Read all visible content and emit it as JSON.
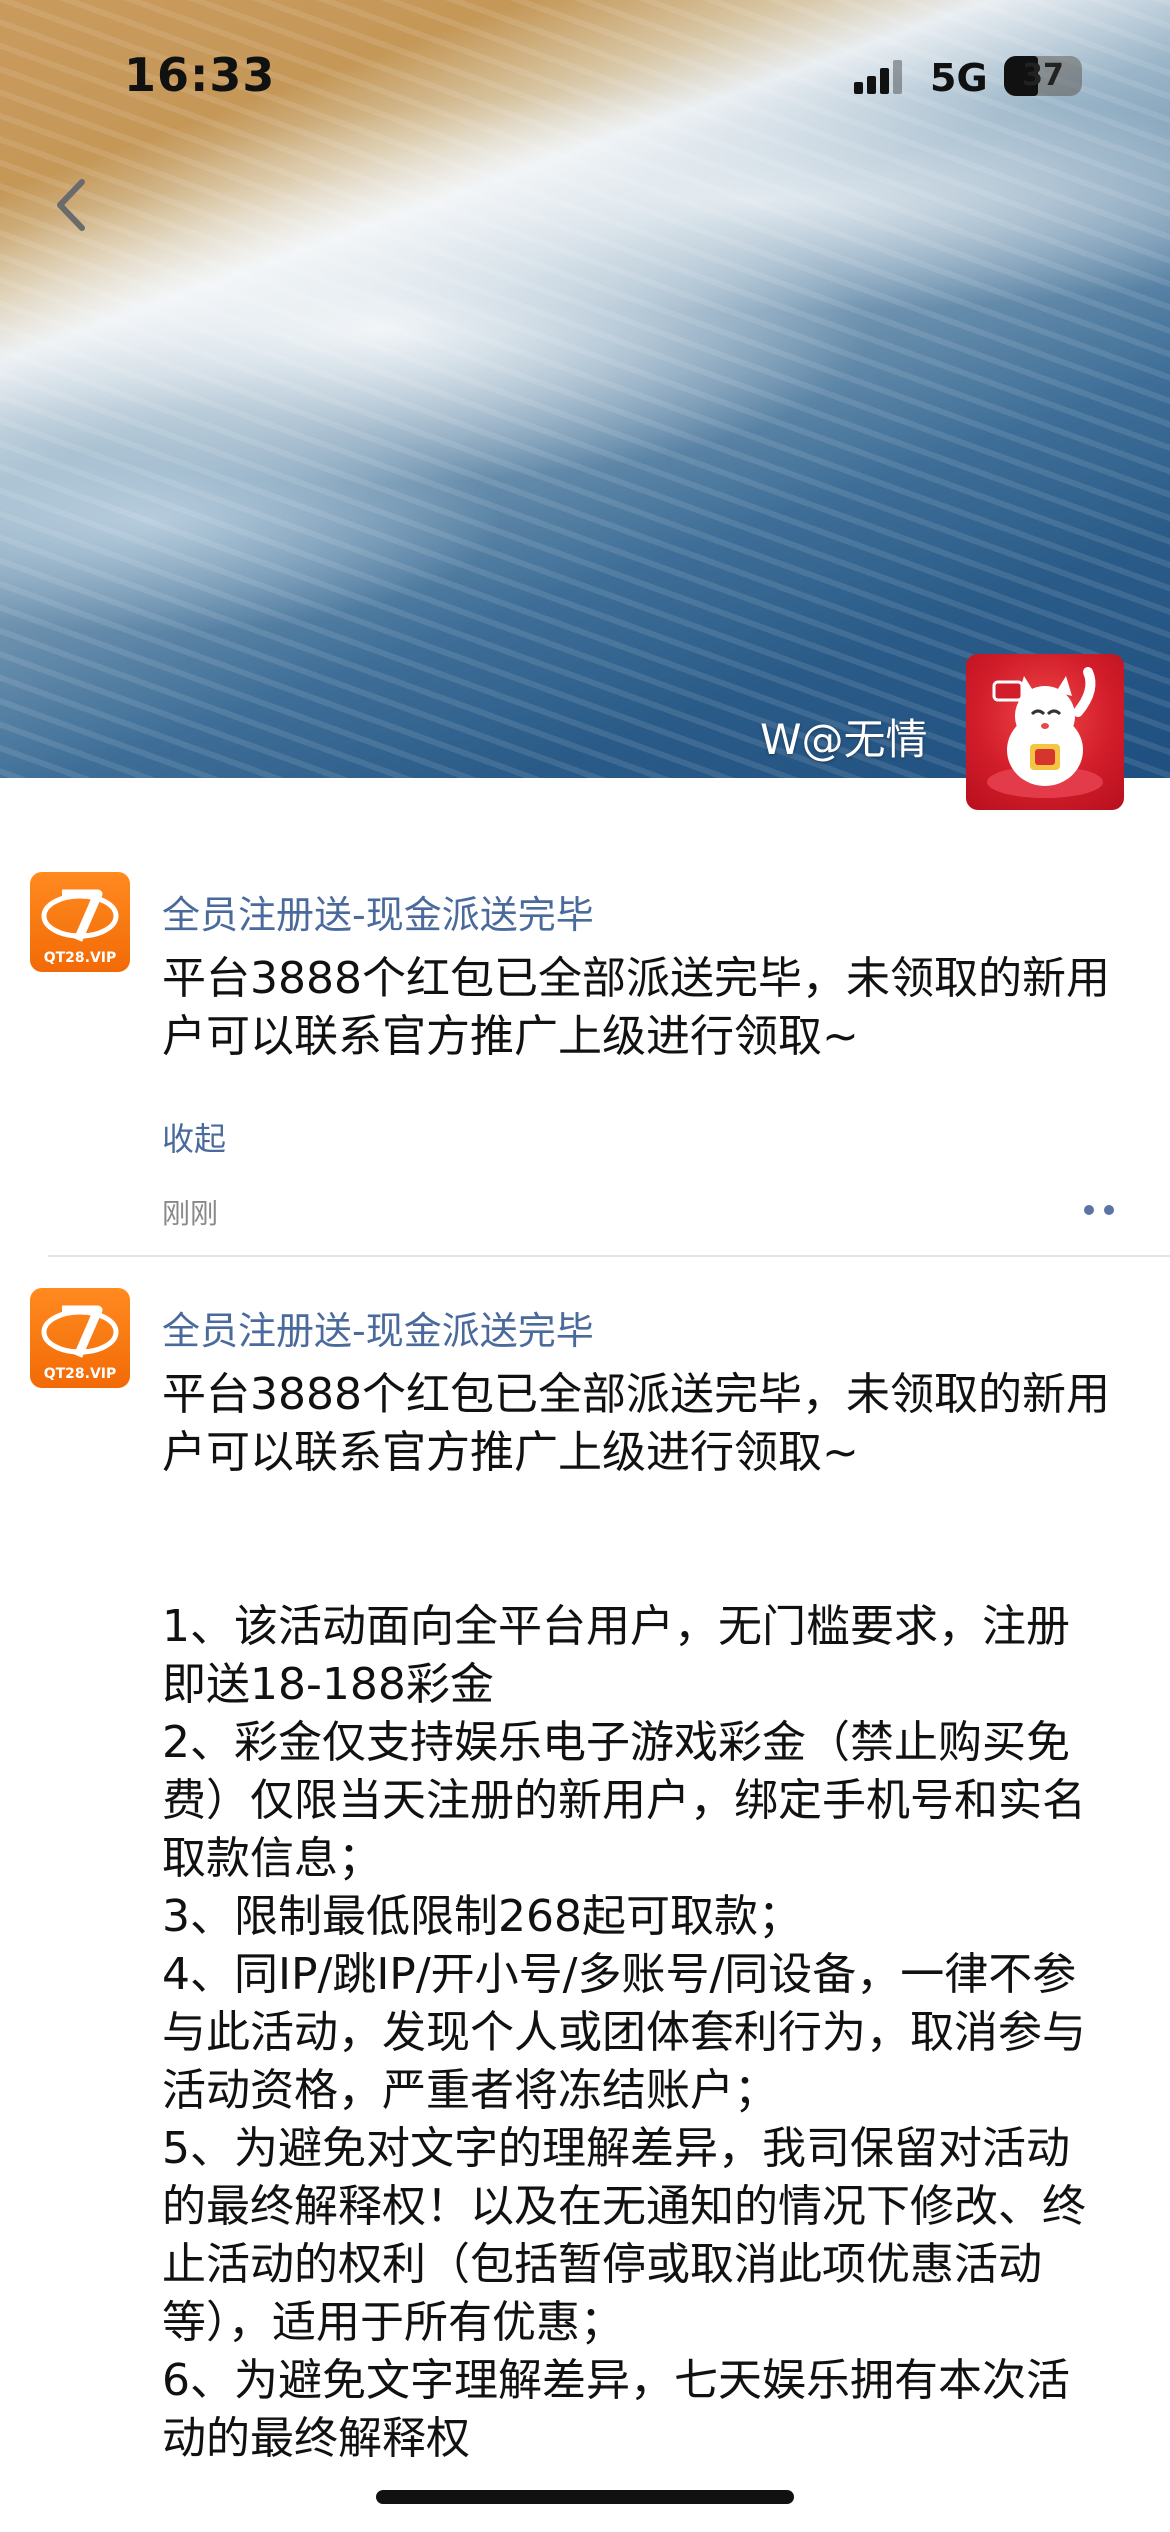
{
  "status_bar": {
    "time": "16:33",
    "network": "5G",
    "battery": "37"
  },
  "header": {
    "owner_name": "W@无情",
    "back_icon": "chevron-left-icon"
  },
  "posts": [
    {
      "title": "全员注册送-现金派送完毕",
      "body": "平台3888个红包已全部派送完毕，未领取的新用户可以联系官方推广上级进行领取~",
      "collapse_label": "收起",
      "time": "刚刚",
      "logo_text": "QT28.VIP"
    },
    {
      "title": "全员注册送-现金派送完毕",
      "body": "平台3888个红包已全部派送完毕，未领取的新用户可以联系官方推广上级进行领取~\n\n\n1、该活动面向全平台用户，无门槛要求，注册即送18-188彩金\n2、彩金仅支持娱乐电子游戏彩金（禁止购买免费）仅限当天注册的新用户，绑定手机号和实名取款信息；\n3、限制最低限制268起可取款；\n4、同IP/跳IP/开小号/多账号/同设备，一律不参与此活动，发现个人或团体套利行为，取消参与活动资格，严重者将冻结账户；\n5、为避免对文字的理解差异，我司保留对活动的最终解释权！以及在无通知的情况下修改、终止活动的权利（包括暂停或取消此项优惠活动等），适用于所有优惠；\n6、为避免文字理解差异，七天娱乐拥有本次活动的最终解释权",
      "logo_text": "QT28.VIP"
    }
  ]
}
